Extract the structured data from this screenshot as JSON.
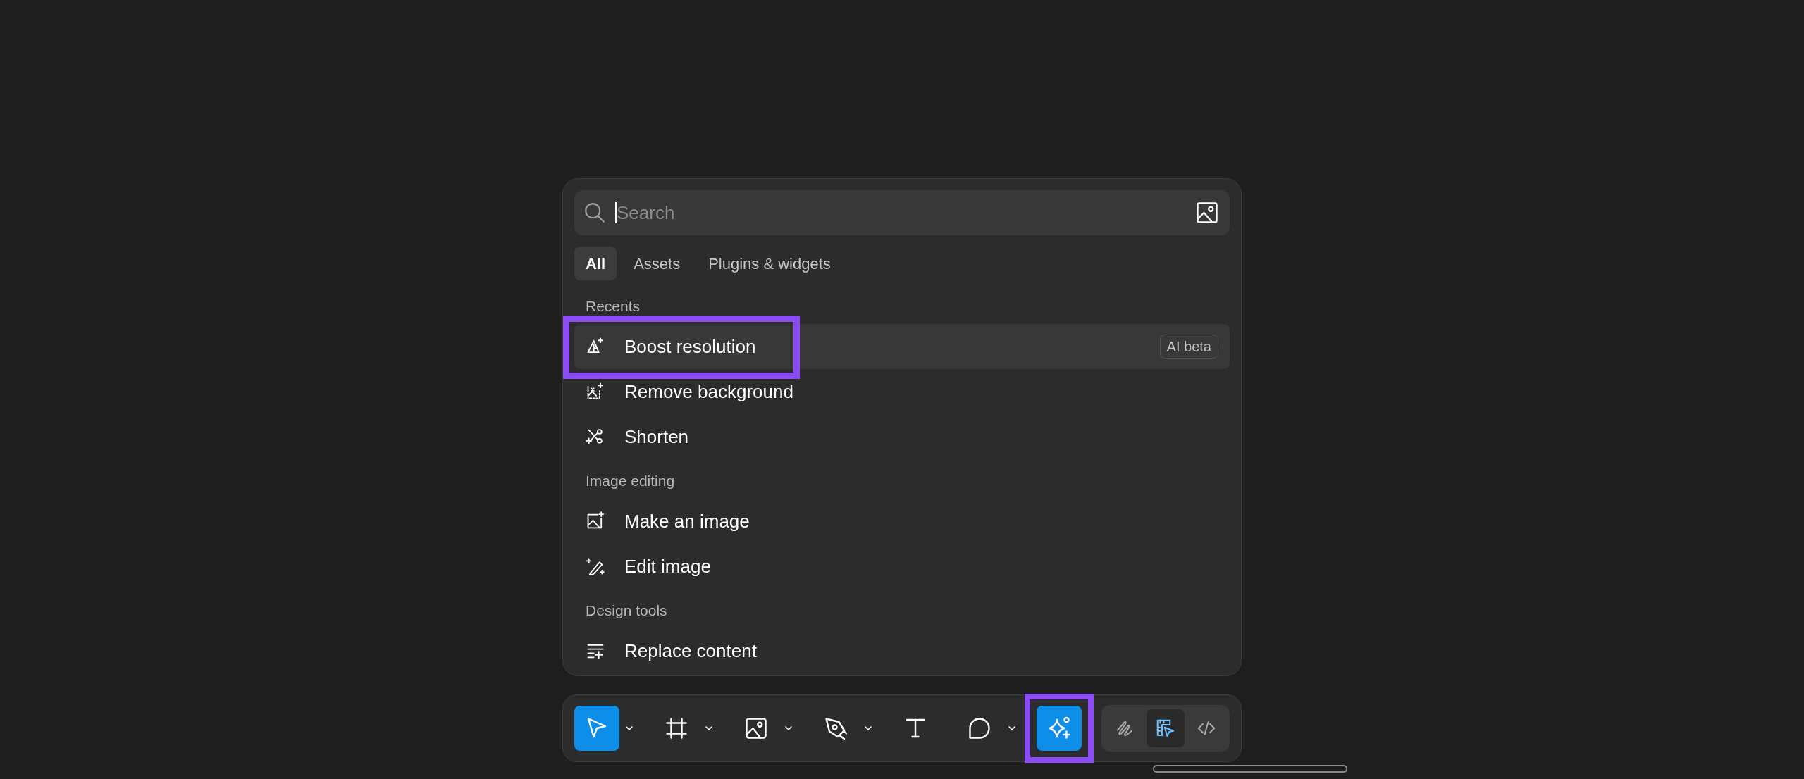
{
  "search": {
    "placeholder": "Search"
  },
  "tabs": [
    {
      "label": "All",
      "selected": true
    },
    {
      "label": "Assets",
      "selected": false
    },
    {
      "label": "Plugins & widgets",
      "selected": false
    }
  ],
  "sections": [
    {
      "title": "Recents",
      "items": [
        {
          "label": "Boost resolution",
          "kind": "boost",
          "hovered": true,
          "annotated": true,
          "badge": "AI beta"
        },
        {
          "label": "Remove background",
          "kind": "remove-bg",
          "hovered": false,
          "annotated": false
        },
        {
          "label": "Shorten",
          "kind": "shorten",
          "hovered": false,
          "annotated": false
        }
      ]
    },
    {
      "title": "Image editing",
      "items": [
        {
          "label": "Make an image",
          "kind": "make-image",
          "hovered": false,
          "annotated": false
        },
        {
          "label": "Edit image",
          "kind": "edit-image",
          "hovered": false,
          "annotated": false
        }
      ]
    },
    {
      "title": "Design tools",
      "items": [
        {
          "label": "Replace content",
          "kind": "replace",
          "hovered": false,
          "annotated": false
        }
      ]
    }
  ],
  "toolbar": {
    "tools": [
      {
        "kind": "move",
        "selected": true,
        "dropdown": true,
        "annotated": false
      },
      {
        "kind": "frame",
        "selected": false,
        "dropdown": true,
        "annotated": false
      },
      {
        "kind": "image",
        "selected": false,
        "dropdown": true,
        "annotated": false
      },
      {
        "kind": "pen",
        "selected": false,
        "dropdown": true,
        "annotated": false
      },
      {
        "kind": "text",
        "selected": false,
        "dropdown": false,
        "annotated": false
      },
      {
        "kind": "comment",
        "selected": false,
        "dropdown": true,
        "annotated": false
      },
      {
        "kind": "ai",
        "selected": true,
        "dropdown": false,
        "annotated": true
      }
    ],
    "modes": [
      {
        "kind": "draw",
        "selected": false
      },
      {
        "kind": "design",
        "selected": true
      },
      {
        "kind": "dev",
        "selected": false
      }
    ]
  }
}
